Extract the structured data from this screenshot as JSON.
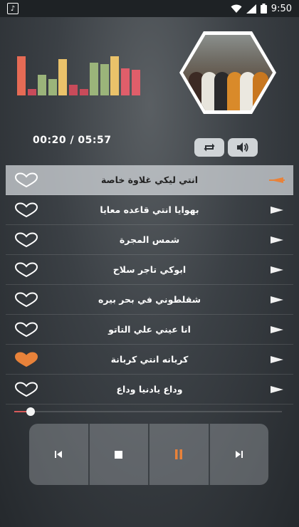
{
  "status_bar": {
    "time": "9:50",
    "icons": [
      "music-note-icon",
      "wifi-icon",
      "signal-icon",
      "battery-icon"
    ]
  },
  "equalizer": {
    "levels": [
      0.95,
      0.15,
      0.5,
      0.4,
      0.88,
      0.25,
      0.15,
      0.8,
      0.75,
      0.95,
      0.65,
      0.62
    ],
    "colors": [
      "#e66b55",
      "#c84b5a",
      "#9bb47a",
      "#9bb47a",
      "#eac26a",
      "#c84b5a",
      "#c84b5a",
      "#9bb47a",
      "#9bb47a",
      "#eac26a",
      "#e05e6a",
      "#e05e6a"
    ]
  },
  "player": {
    "time_display": "00:20 / 05:57",
    "seek_progress": 0.06,
    "repeat_icon": "repeat-icon",
    "volume_icon": "volume-icon"
  },
  "tracks": [
    {
      "title": "انتي ليكي غلاوة خاصة",
      "active": true,
      "favorite": false
    },
    {
      "title": "بهوايا انتي قاعده معايا",
      "active": false,
      "favorite": false
    },
    {
      "title": "شمس المجرة",
      "active": false,
      "favorite": false
    },
    {
      "title": "ابوكي تاجر سلاح",
      "active": false,
      "favorite": false
    },
    {
      "title": "شقلطوني في بحر بيره",
      "active": false,
      "favorite": false
    },
    {
      "title": "انا عيني علي التاتو",
      "active": false,
      "favorite": false
    },
    {
      "title": "كربانه انتي كربانة",
      "active": false,
      "favorite": true
    },
    {
      "title": "وداع يادنيا وداع",
      "active": false,
      "favorite": false
    }
  ],
  "controls": [
    {
      "name": "previous-button",
      "icon": "skip-previous-icon"
    },
    {
      "name": "stop-button",
      "icon": "stop-icon"
    },
    {
      "name": "pause-button",
      "icon": "pause-icon"
    },
    {
      "name": "next-button",
      "icon": "skip-next-icon"
    }
  ],
  "colors": {
    "accent": "#e8823a",
    "favorite": "#e8823a",
    "seek": "#d85a5a"
  }
}
